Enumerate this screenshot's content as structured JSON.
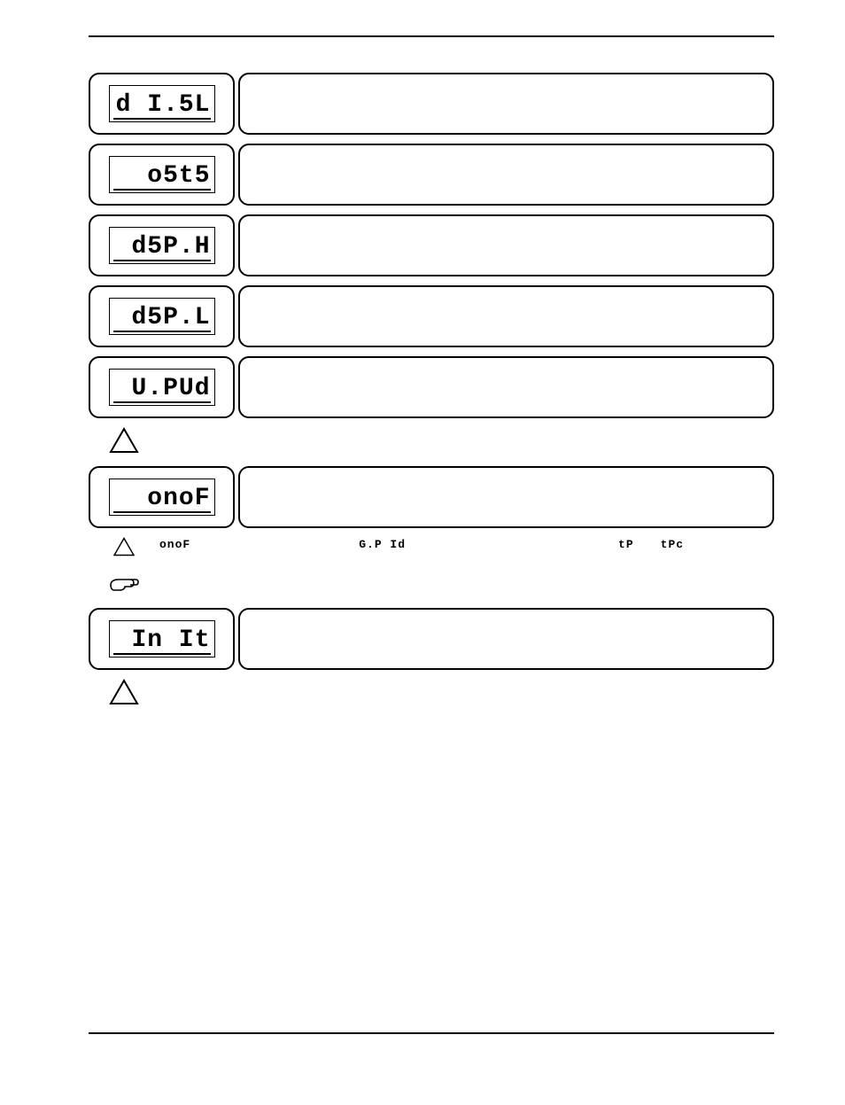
{
  "rows": [
    {
      "lcd": "d I.5L"
    },
    {
      "lcd": "o5t5"
    },
    {
      "lcd": "d5P.H"
    },
    {
      "lcd": "d5P.L"
    },
    {
      "lcd": "U.PUd"
    }
  ],
  "notes1": {
    "icon": "warning-triangle-icon",
    "text": ""
  },
  "row_onof": {
    "lcd": "onoF"
  },
  "notes_onof": {
    "line1_pre": "onoF",
    "line1_mid1": "G.P Id",
    "line1_mid2": "tP",
    "line1_end": "tPc"
  },
  "notes_hand": {
    "icon": "pointing-hand-icon",
    "text": ""
  },
  "row_init": {
    "lcd": "In It"
  },
  "notes_init": {
    "icon": "warning-triangle-icon",
    "text": ""
  }
}
